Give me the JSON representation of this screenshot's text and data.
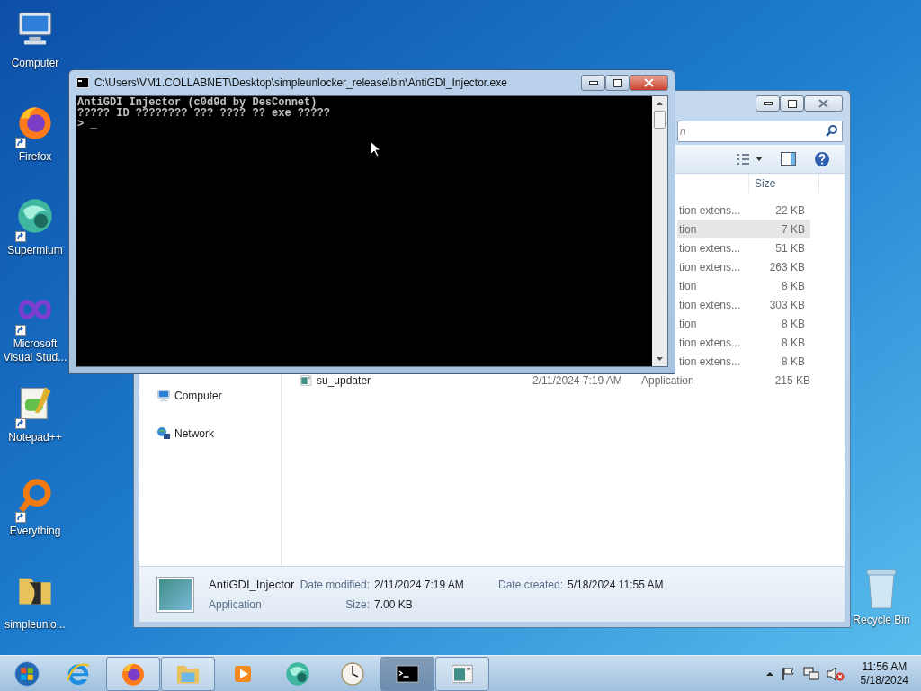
{
  "desktop_icons": [
    {
      "kind": "computer",
      "label": "Computer",
      "shortcut": false
    },
    {
      "kind": "firefox",
      "label": "Firefox",
      "shortcut": true
    },
    {
      "kind": "supermium",
      "label": "Supermium",
      "shortcut": true
    },
    {
      "kind": "vs",
      "label": "Microsoft Visual Stud...",
      "shortcut": true
    },
    {
      "kind": "notepad",
      "label": "Notepad++",
      "shortcut": true
    },
    {
      "kind": "everything",
      "label": "Everything",
      "shortcut": true
    },
    {
      "kind": "folder",
      "label": "simpleunlo...",
      "shortcut": false
    }
  ],
  "recycle_bin": {
    "label": "Recycle Bin"
  },
  "explorer": {
    "search": {
      "placeholder": "n"
    },
    "columns": [
      "Size"
    ],
    "nav": [
      {
        "kind": "computer",
        "label": "Computer"
      },
      {
        "kind": "network",
        "label": "Network"
      }
    ],
    "rows": [
      {
        "type": "tion extens...",
        "size": "22 KB",
        "selected": false
      },
      {
        "type": "tion",
        "size": "7 KB",
        "selected": true
      },
      {
        "type": "tion extens...",
        "size": "51 KB",
        "selected": false
      },
      {
        "type": "tion extens...",
        "size": "263 KB",
        "selected": false
      },
      {
        "type": "tion",
        "size": "8 KB",
        "selected": false
      },
      {
        "type": "tion extens...",
        "size": "303 KB",
        "selected": false
      },
      {
        "type": "tion",
        "size": "8 KB",
        "selected": false
      },
      {
        "type": "tion extens...",
        "size": "8 KB",
        "selected": false
      },
      {
        "type": "tion extens...",
        "size": "8 KB",
        "selected": false
      },
      {
        "name": "su_updater",
        "date": "2/11/2024 7:19 AM",
        "type": "Application",
        "size": "215 KB",
        "selected": false
      }
    ],
    "details": {
      "name": "AntiGDI_Injector",
      "type": "Application",
      "modified_label": "Date modified:",
      "modified": "2/11/2024 7:19 AM",
      "size_label": "Size:",
      "size": "7.00 KB",
      "created_label": "Date created:",
      "created": "5/18/2024 11:55 AM"
    }
  },
  "console": {
    "title": "C:\\Users\\VM1.COLLABNET\\Desktop\\simpleunlocker_release\\bin\\AntiGDI_Injector.exe",
    "lines": [
      "AntiGDI Injector (c0d9d by DesConnet)",
      "????? ID ???????? ??? ???? ?? exe ?????",
      "> _"
    ]
  },
  "taskbar": {
    "items": [
      {
        "kind": "start",
        "running": false,
        "active": false
      },
      {
        "kind": "ie",
        "running": false,
        "active": false
      },
      {
        "kind": "firefox",
        "running": true,
        "active": false
      },
      {
        "kind": "explorer",
        "running": true,
        "active": false
      },
      {
        "kind": "media",
        "running": false,
        "active": false
      },
      {
        "kind": "supermium",
        "running": false,
        "active": false
      },
      {
        "kind": "clock",
        "running": false,
        "active": false
      },
      {
        "kind": "cmd",
        "running": true,
        "active": true
      },
      {
        "kind": "app",
        "running": true,
        "active": false
      }
    ],
    "clock": {
      "time": "11:56 AM",
      "date": "5/18/2024"
    }
  }
}
